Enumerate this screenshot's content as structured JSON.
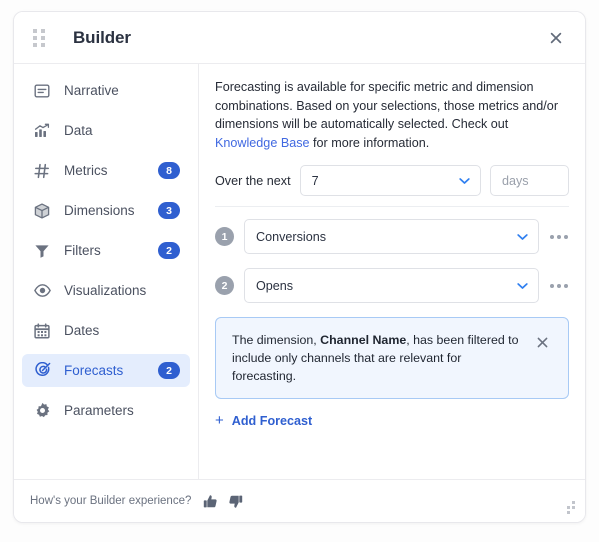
{
  "window": {
    "title": "Builder",
    "drag_handle_icon": "grip-dots-icon",
    "close_icon": "close-icon"
  },
  "sidebar": {
    "items": [
      {
        "label": "Narrative",
        "icon": "narrative-icon",
        "badge": "",
        "active": false
      },
      {
        "label": "Data",
        "icon": "data-chart-icon",
        "badge": "",
        "active": false
      },
      {
        "label": "Metrics",
        "icon": "hash-icon",
        "badge": "8",
        "active": false
      },
      {
        "label": "Dimensions",
        "icon": "cube-icon",
        "badge": "3",
        "active": false
      },
      {
        "label": "Filters",
        "icon": "filter-icon",
        "badge": "2",
        "active": false
      },
      {
        "label": "Visualizations",
        "icon": "eye-icon",
        "badge": "",
        "active": false
      },
      {
        "label": "Dates",
        "icon": "calendar-icon",
        "badge": "",
        "active": false
      },
      {
        "label": "Forecasts",
        "icon": "target-icon",
        "badge": "2",
        "active": true
      },
      {
        "label": "Parameters",
        "icon": "gear-icon",
        "badge": "",
        "active": false
      }
    ]
  },
  "main": {
    "intro": {
      "part1": "Forecasting is available for specific metric and dimension combinations. Based on your selections, those metrics and/or dimensions will be automatically selected. Check out ",
      "link": "Knowledge Base",
      "part2": " for more information."
    },
    "duration": {
      "label": "Over the next",
      "value": "7",
      "unit_placeholder": "days",
      "chevron_icon": "chevron-down-icon"
    },
    "forecasts": [
      {
        "number": "1",
        "value": "Conversions",
        "menu_icon": "kebab-menu-icon",
        "chevron_icon": "chevron-down-icon"
      },
      {
        "number": "2",
        "value": "Opens",
        "menu_icon": "kebab-menu-icon",
        "chevron_icon": "chevron-down-icon"
      }
    ],
    "notice": {
      "text_before": "The dimension, ",
      "bold": "Channel Name",
      "text_after": ", has been filtered to include only channels that are relevant for forecasting.",
      "close_icon": "close-icon"
    },
    "add_forecast": {
      "plus": "+",
      "label": "Add Forecast"
    }
  },
  "footer": {
    "question": "How's your Builder experience?",
    "thumbs_up_icon": "thumbs-up-icon",
    "thumbs_down_icon": "thumbs-down-icon",
    "resize_icon": "resize-grip-icon"
  },
  "colors": {
    "accent": "#2f5fd0",
    "link": "#4169e1",
    "active_bg": "#e4edfd",
    "notice_bg": "#f1f6fe",
    "notice_border": "#a8caf5",
    "badge_bg": "#2f5fd0",
    "number_bg": "#9aa1ad"
  }
}
